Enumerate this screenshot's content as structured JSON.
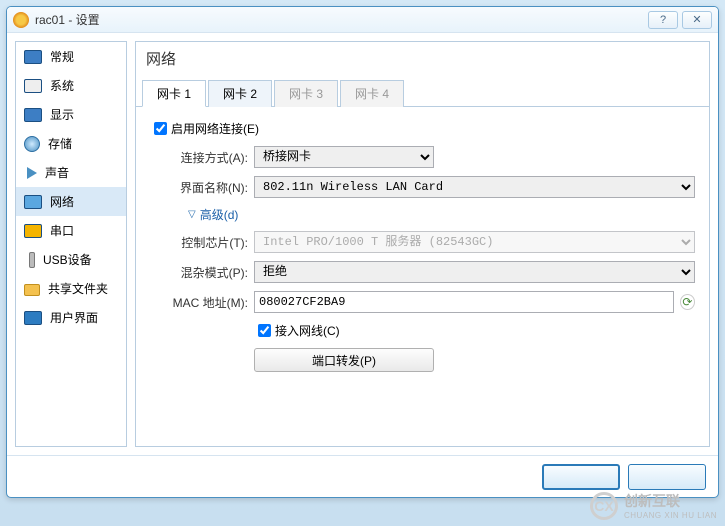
{
  "window": {
    "title": "rac01 - 设置"
  },
  "sidebar": {
    "items": [
      {
        "label": "常规"
      },
      {
        "label": "系统"
      },
      {
        "label": "显示"
      },
      {
        "label": "存储"
      },
      {
        "label": "声音"
      },
      {
        "label": "网络"
      },
      {
        "label": "串口"
      },
      {
        "label": "USB设备"
      },
      {
        "label": "共享文件夹"
      },
      {
        "label": "用户界面"
      }
    ]
  },
  "page": {
    "title": "网络"
  },
  "tabs": [
    {
      "label": "网卡 1",
      "active": true
    },
    {
      "label": "网卡 2"
    },
    {
      "label": "网卡 3",
      "disabled": true
    },
    {
      "label": "网卡 4",
      "disabled": true
    }
  ],
  "form": {
    "enable_label": "启用网络连接(E)",
    "enable_checked": true,
    "attach_label": "连接方式(A):",
    "attach_value": "桥接网卡",
    "name_label": "界面名称(N):",
    "name_value": "802.11n Wireless LAN Card",
    "advanced_label": "高级(d)",
    "adapter_label": "控制芯片(T):",
    "adapter_value": "Intel PRO/1000 T 服务器 (82543GC)",
    "promisc_label": "混杂模式(P):",
    "promisc_value": "拒绝",
    "mac_label": "MAC 地址(M):",
    "mac_value": "080027CF2BA9",
    "cable_label": "接入网线(C)",
    "cable_checked": true,
    "portfwd_label": "端口转发(P)"
  },
  "footer": {
    "ok": "",
    "cancel": ""
  },
  "watermark": {
    "brand": "创新互联",
    "sub": "CHUANG XIN HU LIAN"
  }
}
